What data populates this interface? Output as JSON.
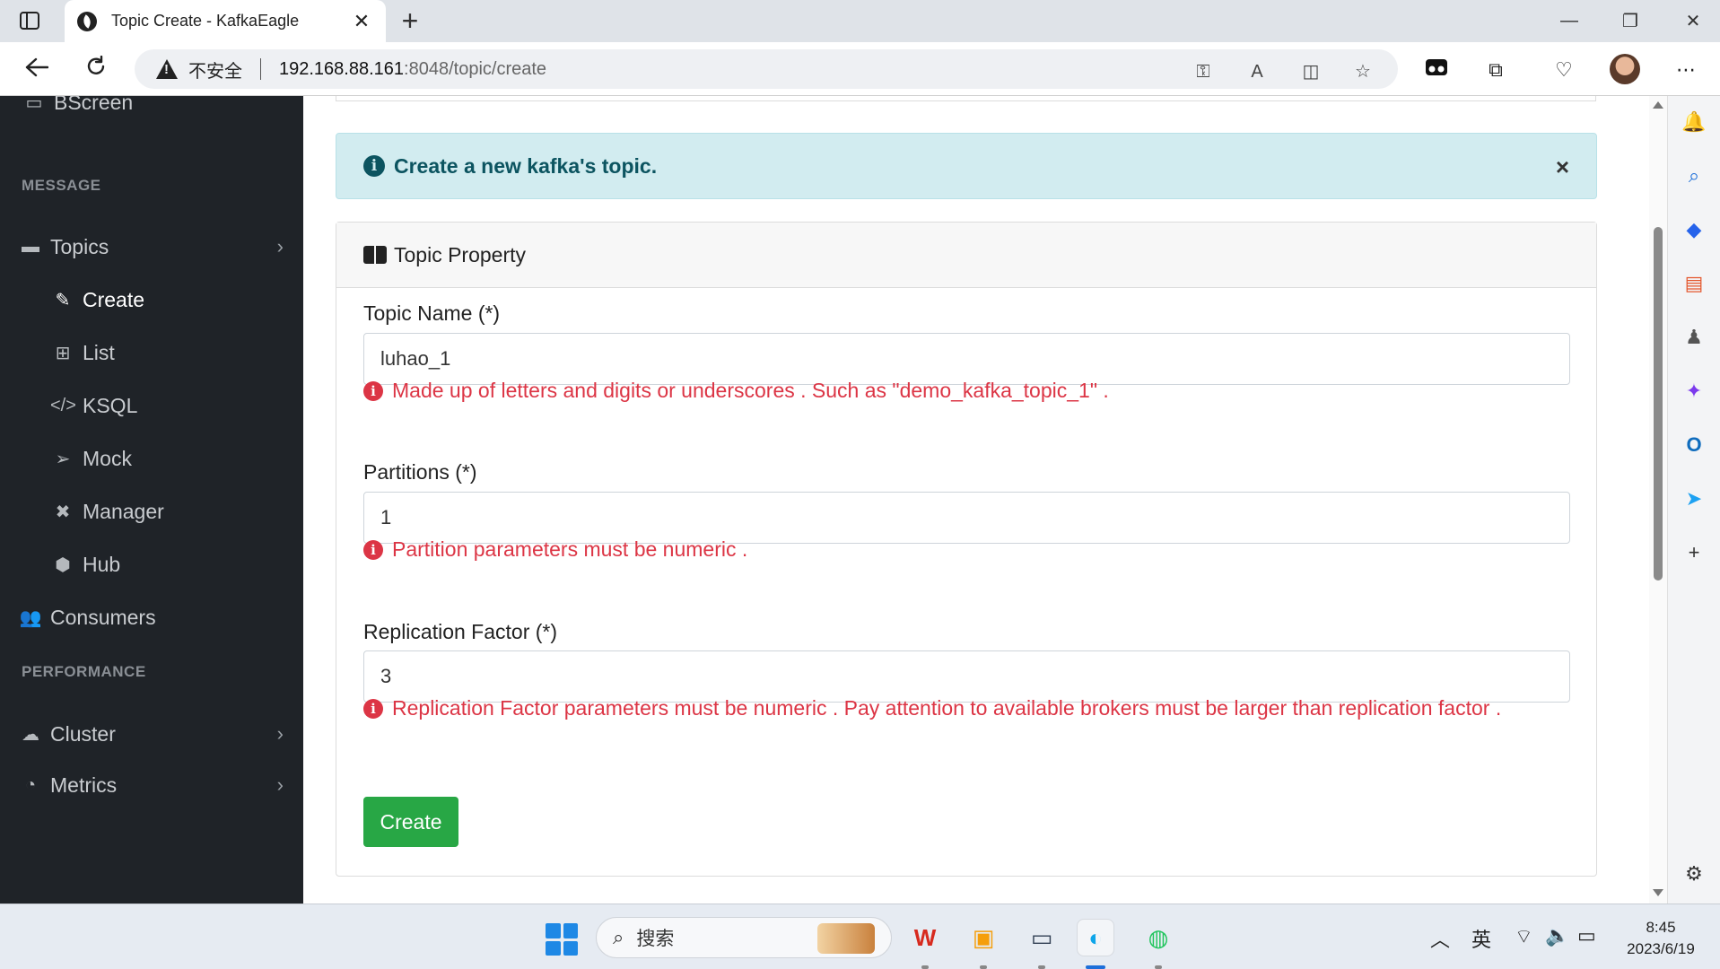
{
  "browser": {
    "tab_title": "Topic Create - KafkaEagle",
    "tab_close": "✕",
    "new_tab": "+",
    "insecure_label": "不安全",
    "url_host": "192.168.88.161",
    "url_path": ":8048/topic/create",
    "window_controls": {
      "minimize": "—",
      "restore": "❐",
      "close": "✕"
    }
  },
  "sidebar": {
    "partial_top": {
      "label": "BScreen",
      "icon": "monitor-icon"
    },
    "section_message": "MESSAGE",
    "items": [
      {
        "label": "Topics",
        "icon": "comment-icon",
        "has_chevron": true
      },
      {
        "label": "Create",
        "icon": "edit-icon",
        "active": true
      },
      {
        "label": "List",
        "icon": "table-icon"
      },
      {
        "label": "KSQL",
        "icon": "code-icon"
      },
      {
        "label": "Mock",
        "icon": "paper-plane-icon"
      },
      {
        "label": "Manager",
        "icon": "tools-icon"
      },
      {
        "label": "Hub",
        "icon": "cube-icon"
      },
      {
        "label": "Consumers",
        "icon": "users-icon"
      }
    ],
    "section_performance": "PERFORMANCE",
    "perf_items": [
      {
        "label": "Cluster",
        "icon": "cloud-icon",
        "has_chevron": true
      },
      {
        "label": "Metrics",
        "icon": "chart-icon",
        "has_chevron": true
      }
    ],
    "chevron": "›"
  },
  "alert": {
    "message": "Create a new kafka's topic.",
    "close": "×",
    "color": "#0c5460"
  },
  "card": {
    "title": "Topic Property",
    "fields": [
      {
        "label": "Topic Name (*)",
        "value": "luhao_1",
        "help": "Made up of letters and digits or underscores . Such as \"demo_kafka_topic_1\" ."
      },
      {
        "label": "Partitions (*)",
        "value": "1",
        "help": "Partition parameters must be numeric ."
      },
      {
        "label": "Replication Factor (*)",
        "value": "3",
        "help": "Replication Factor parameters must be numeric . Pay attention to available brokers must be larger than replication factor ."
      }
    ],
    "submit_label": "Create",
    "submit_color": "#28a745",
    "error_color": "#dc3545"
  },
  "taskbar": {
    "search_label": "搜索",
    "ime": "英",
    "time": "8:45",
    "date": "2023/6/19"
  }
}
